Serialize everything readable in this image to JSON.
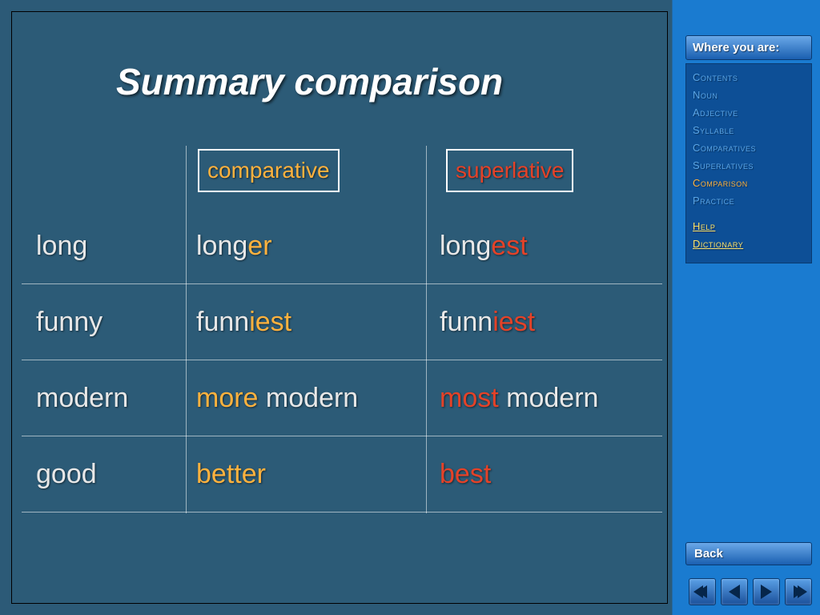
{
  "title": "Summary comparison",
  "columns": {
    "comparative": "comparative",
    "superlative": "superlative"
  },
  "rows": [
    {
      "base": "long",
      "comp": {
        "kind": "suffix",
        "stem": "long",
        "suffix": "er"
      },
      "sup": {
        "kind": "suffix",
        "stem": "long",
        "suffix": "est"
      }
    },
    {
      "base": "funny",
      "comp": {
        "kind": "suffix",
        "stem": "funn",
        "suffix": "iest"
      },
      "sup": {
        "kind": "suffix",
        "stem": "funn",
        "suffix": "iest"
      }
    },
    {
      "base": "modern",
      "comp": {
        "kind": "prefix",
        "prefix": "more",
        "stem": "modern"
      },
      "sup": {
        "kind": "prefix",
        "prefix": "most",
        "stem": "modern"
      }
    },
    {
      "base": "good",
      "comp": {
        "kind": "full",
        "word": "better"
      },
      "sup": {
        "kind": "full",
        "word": "best"
      }
    }
  ],
  "sidebar": {
    "where": "Where you are:",
    "items": [
      "Contents",
      "Noun",
      "Adjective",
      "Syllable",
      "Comparatives",
      "Superlatives",
      "Comparison",
      "Practice"
    ],
    "active": "Comparison",
    "aux": [
      "Help",
      "Dictionary"
    ],
    "back": "Back"
  }
}
